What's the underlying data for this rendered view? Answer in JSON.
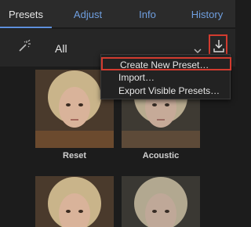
{
  "tabs": [
    {
      "label": "Presets",
      "active": true
    },
    {
      "label": "Adjust",
      "active": false
    },
    {
      "label": "Info",
      "active": false
    },
    {
      "label": "History",
      "active": false
    }
  ],
  "toolbar": {
    "filter_value": "All",
    "wand_icon": "magic-wand-icon",
    "dropdown_icon": "chevron-down-icon",
    "import_icon": "download-arrow-icon"
  },
  "menu": {
    "items": [
      {
        "label": "Create New Preset…",
        "highlighted": true
      },
      {
        "label": "Import…",
        "highlighted": false
      },
      {
        "label": "Export Visible Presets…",
        "highlighted": false
      }
    ]
  },
  "presets": [
    {
      "label": "Reset",
      "tone": "natural"
    },
    {
      "label": "Acoustic",
      "tone": "muted"
    },
    {
      "label": "",
      "tone": "natural"
    },
    {
      "label": "",
      "tone": "muted"
    }
  ],
  "colors": {
    "accent": "#5d8fdc",
    "highlight_border": "#d23b2f",
    "background": "#1c1c1c",
    "tabbar": "#2b2b2b"
  }
}
